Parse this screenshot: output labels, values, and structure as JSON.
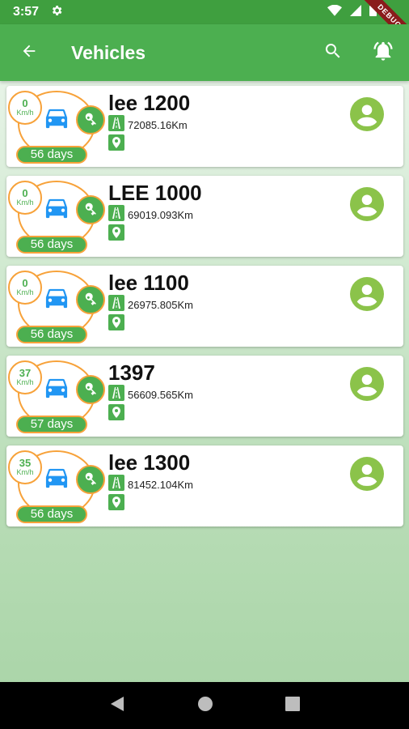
{
  "status_bar": {
    "time": "3:57",
    "debug": "DEBUG"
  },
  "app_bar": {
    "title": "Vehicles"
  },
  "vehicles": [
    {
      "speed": "0",
      "unit": "Km/h",
      "days": "56 days",
      "name": "lee 1200",
      "odometer": "72085.16Km"
    },
    {
      "speed": "0",
      "unit": "Km/h",
      "days": "56 days",
      "name": "LEE 1000",
      "odometer": "69019.093Km"
    },
    {
      "speed": "0",
      "unit": "Km/h",
      "days": "56 days",
      "name": "lee 1100",
      "odometer": "26975.805Km"
    },
    {
      "speed": "37",
      "unit": "Km/h",
      "days": "57 days",
      "name": "1397",
      "odometer": "56609.565Km"
    },
    {
      "speed": "35",
      "unit": "Km/h",
      "days": "56 days",
      "name": "lee 1300",
      "odometer": "81452.104Km"
    }
  ],
  "colors": {
    "primary": "#4caf50",
    "accent": "#f7a23a",
    "car": "#2196f3",
    "avatar": "#8bc34a"
  },
  "icons": [
    "back-arrow-icon",
    "search-icon",
    "bell-icon",
    "car-icon",
    "key-icon",
    "road-icon",
    "location-pin-icon",
    "person-icon"
  ]
}
